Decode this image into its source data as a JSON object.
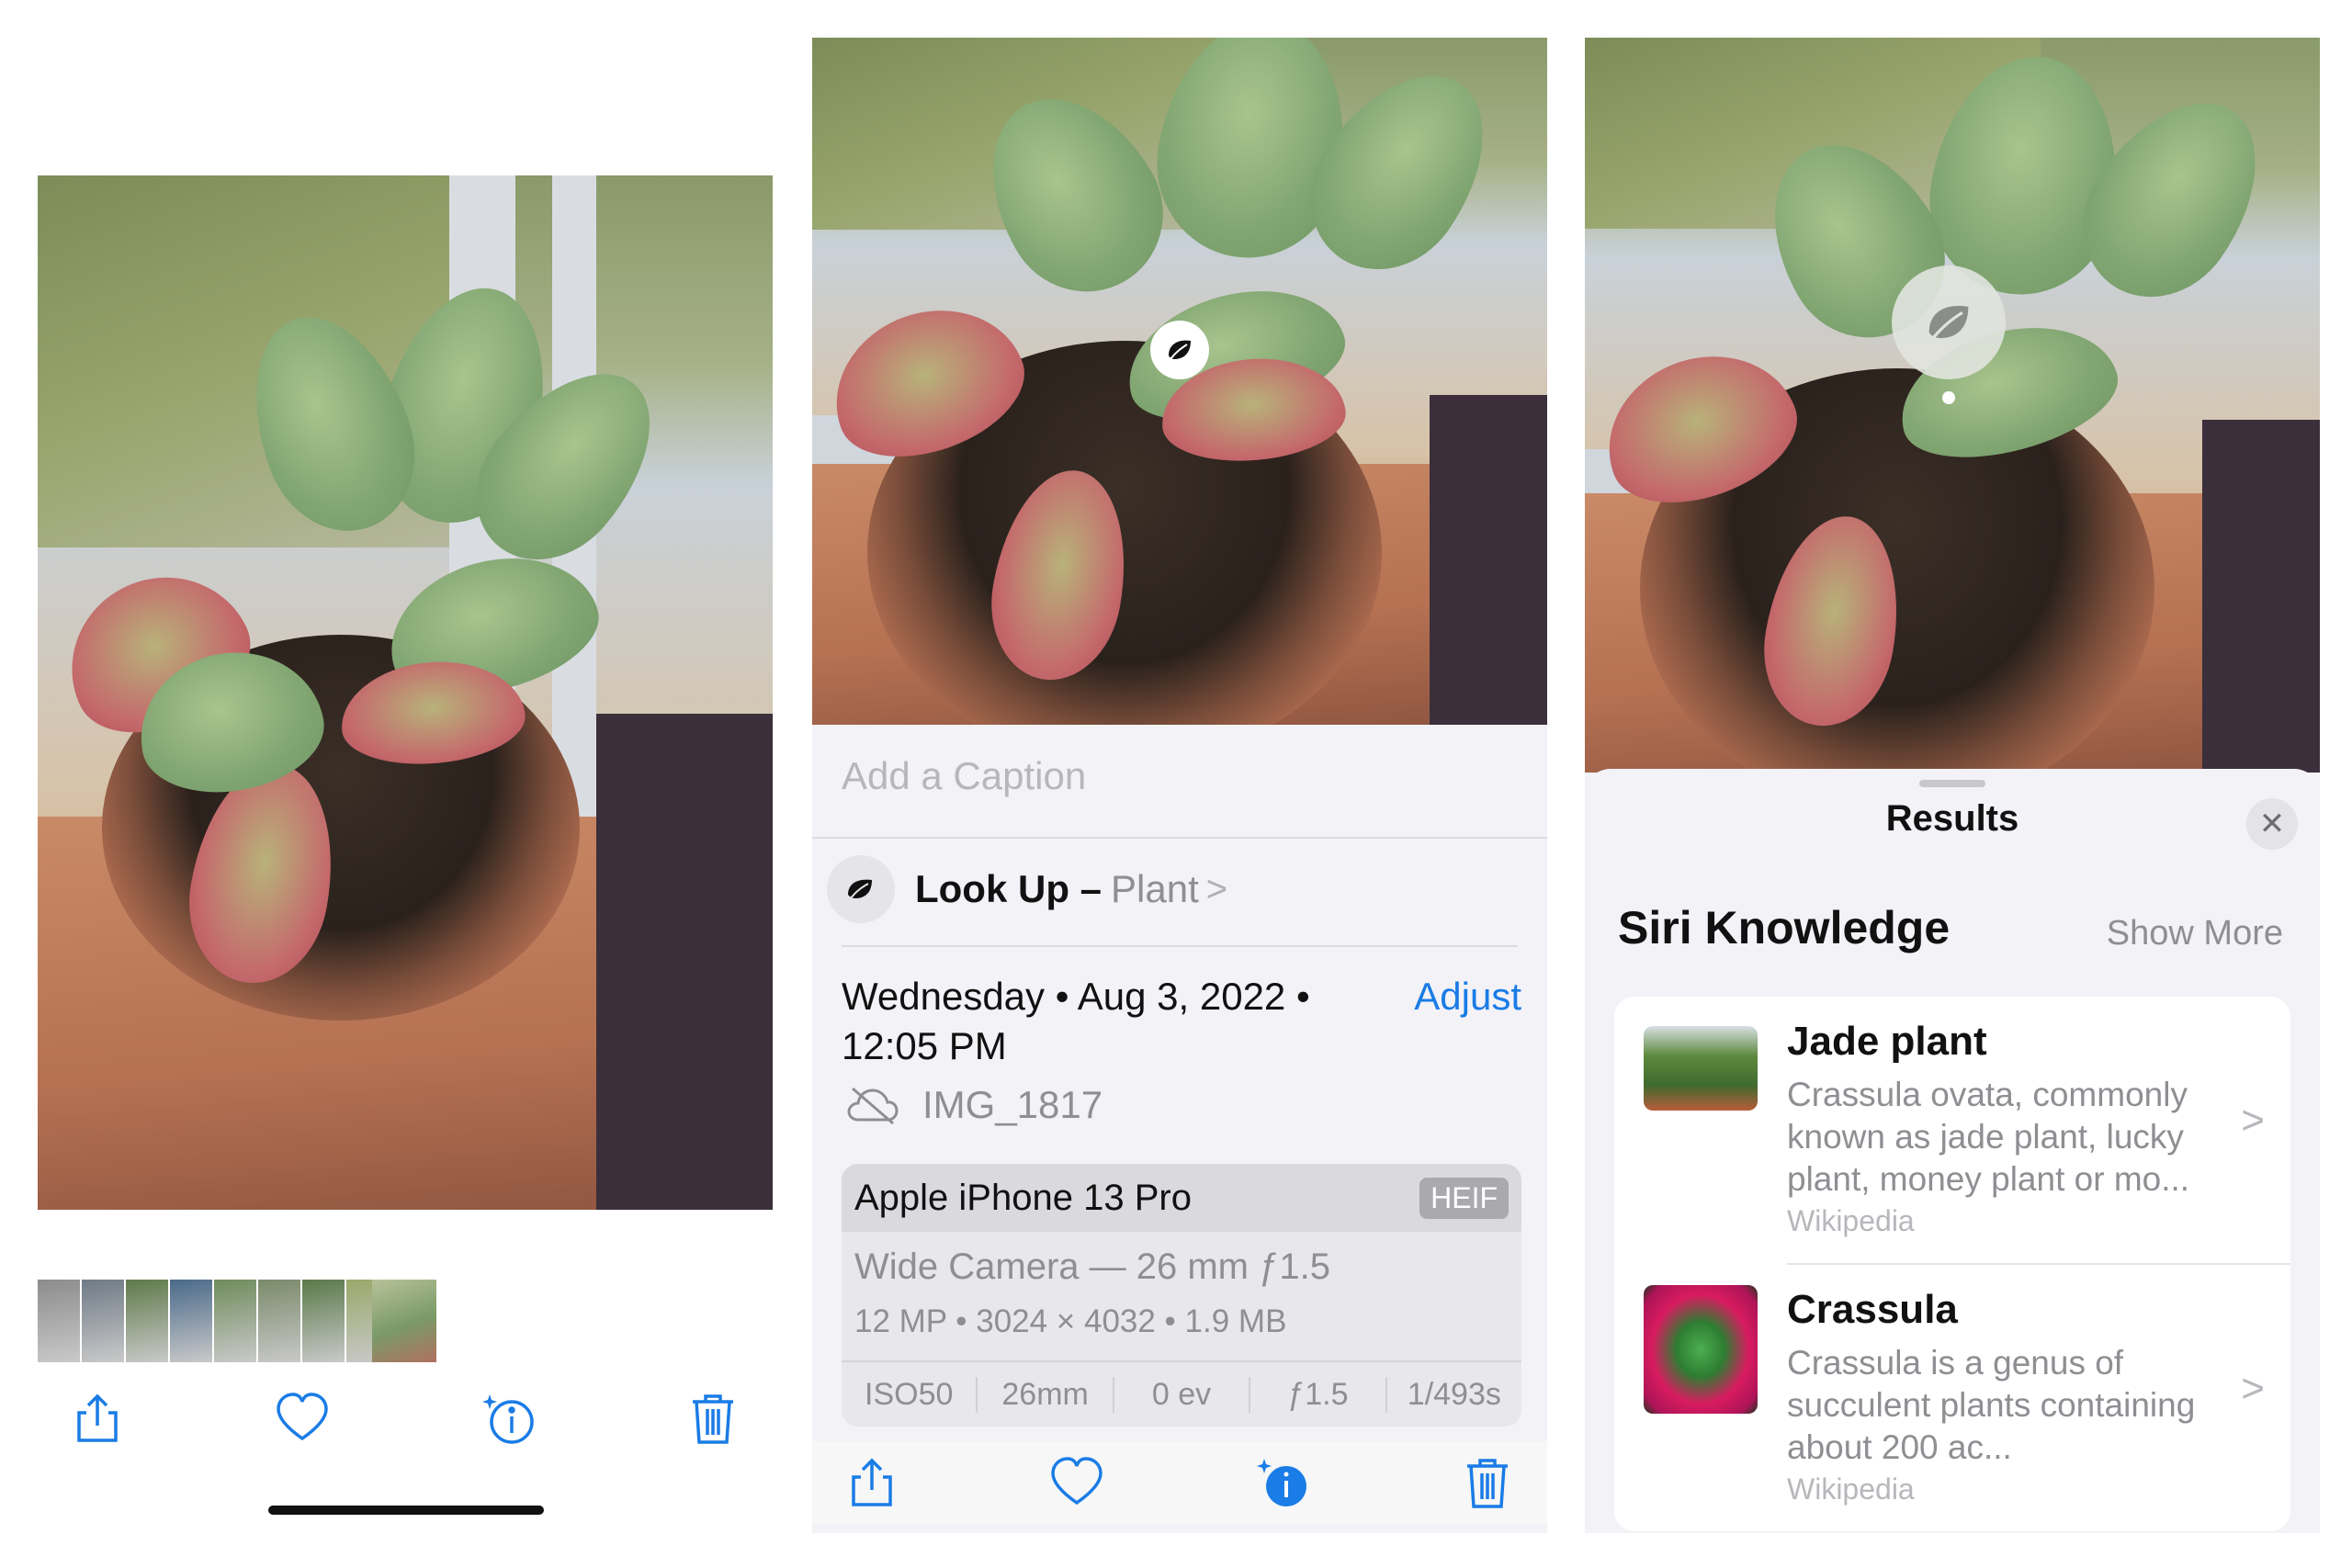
{
  "panel1": {
    "thumbnail_colors": [
      "#8c8c8c",
      "#6f7a86",
      "#5e7a4a",
      "#4a6a8a",
      "#6f8c5c",
      "#7a8a6a",
      "#5a7a4a",
      "#9aa86a"
    ]
  },
  "panel2": {
    "caption_placeholder": "Add a Caption",
    "lookup": {
      "title": "Look Up –",
      "subject": "Plant",
      "chevron": ">"
    },
    "date_line1": "Wednesday • Aug 3, 2022 •",
    "date_line2": "12:05 PM",
    "adjust_label": "Adjust",
    "filename": "IMG_1817",
    "device": {
      "name": "Apple iPhone 13 Pro",
      "format_badge": "HEIF",
      "lens": "Wide Camera — 26 mm ƒ1.5",
      "specs": "12 MP • 3024 × 4032 • 1.9 MB",
      "exif": [
        "ISO50",
        "26mm",
        "0 ev",
        "ƒ1.5",
        "1/493s"
      ]
    }
  },
  "panel3": {
    "sheet_title": "Results",
    "close_icon": "✕",
    "section_title": "Siri Knowledge",
    "show_more": "Show More",
    "results": [
      {
        "name": "Jade plant",
        "description": "Crassula ovata, commonly known as jade plant, lucky plant, money plant or mo...",
        "source": "Wikipedia",
        "chevron": ">"
      },
      {
        "name": "Crassula",
        "description": "Crassula is a genus of succulent plants containing about 200 ac...",
        "source": "Wikipedia",
        "chevron": ">"
      }
    ]
  },
  "colors": {
    "accent": "#1a7ce6",
    "secondary_text": "#8e8e93"
  }
}
